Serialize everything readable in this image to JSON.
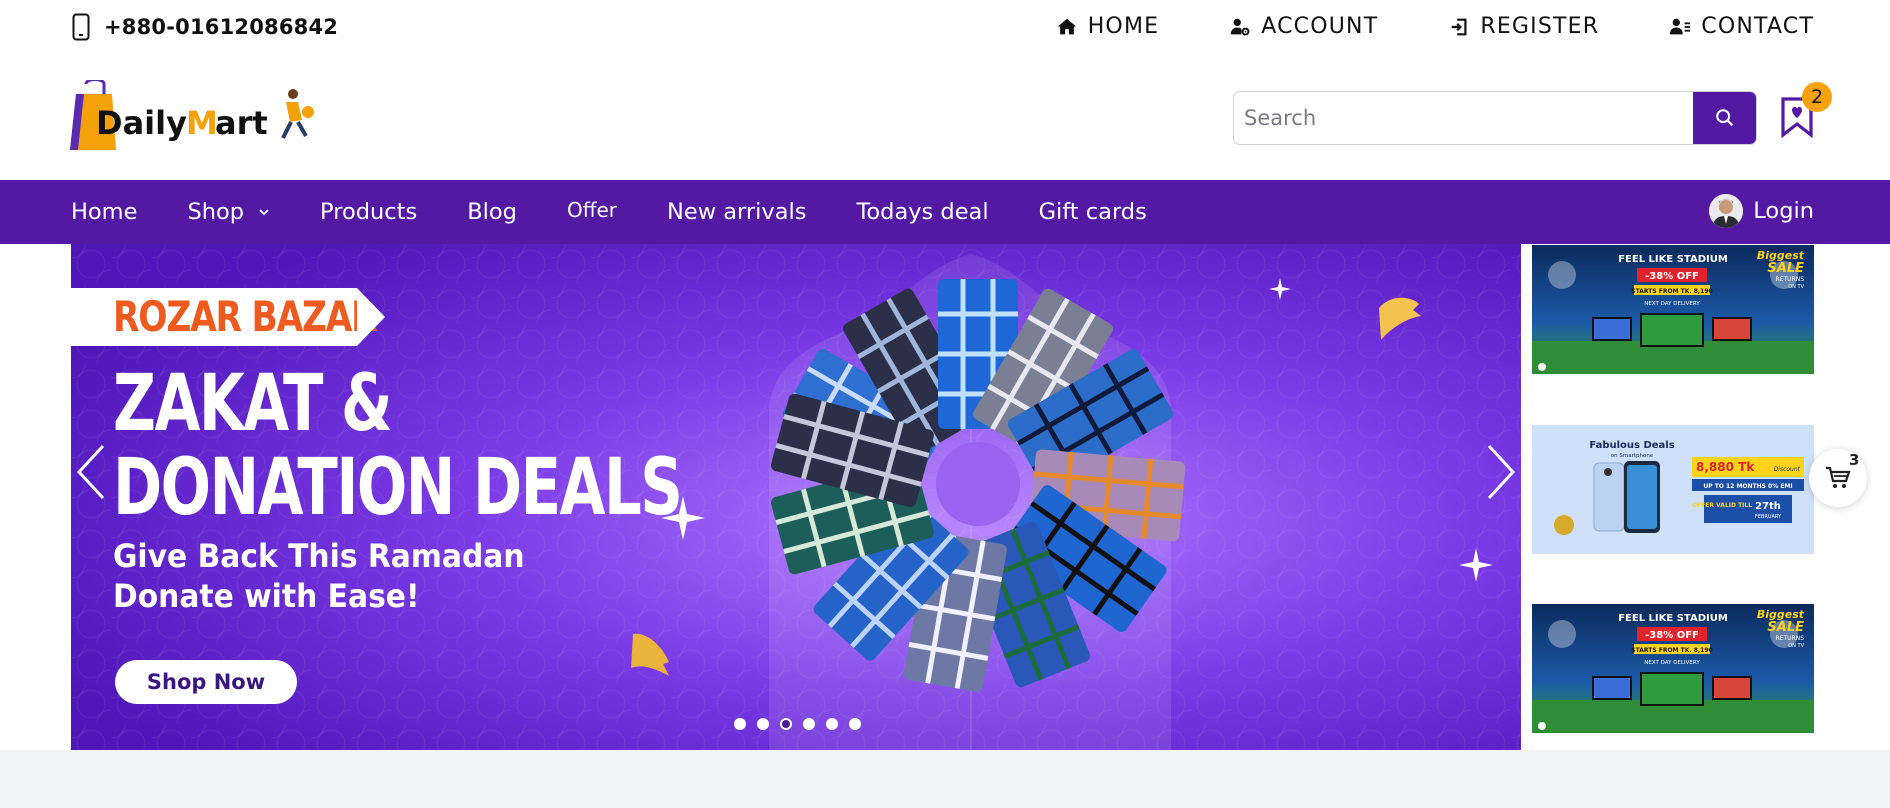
{
  "topbar": {
    "phone": "+880-01612086842",
    "links": [
      {
        "label": "HOME",
        "icon": "home-icon"
      },
      {
        "label": "ACCOUNT",
        "icon": "user-gear-icon"
      },
      {
        "label": "REGISTER",
        "icon": "sign-in-icon"
      },
      {
        "label": "CONTACT",
        "icon": "contact-icon"
      }
    ]
  },
  "header": {
    "logo_text": "DailyMart",
    "search_placeholder": "Search",
    "wishlist_count": "2"
  },
  "nav": {
    "items": [
      "Home",
      "Shop",
      "Products",
      "Blog",
      "Offer",
      "New arrivals",
      "Todays deal",
      "Gift cards"
    ],
    "login": "Login"
  },
  "hero": {
    "tag": "ROZAR BAZAR",
    "headline_1": "ZAKAT &",
    "headline_2": "DONATION DEALS",
    "sub_1": "Give Back This Ramadan",
    "sub_2": "Donate with Ease!",
    "cta": "Shop Now",
    "slides": 6,
    "active_slide": 3
  },
  "side_banners": [
    {
      "top": "FEEL LIKE STADIUM",
      "badge": "-38% OFF",
      "small": "STARTS FROM TK. 8,190",
      "deliv": "NEXT DAY DELIVERY",
      "corner_1": "Biggest",
      "corner_2": "SALE",
      "corner_3": "RETURNS",
      "corner_4": "ON TV"
    },
    {
      "title": "Fabulous Deals",
      "subtitle": "on Smartphone",
      "price": "8,880 Tk",
      "price_note": "Discount",
      "emi": "UP TO 12 MONTHS 0% EMI",
      "offer": "OFFER VALID TILL",
      "date": "27th",
      "month": "FEBRUARY"
    },
    {
      "top": "FEEL LIKE STADIUM",
      "badge": "-38% OFF",
      "small": "STARTS FROM TK. 8,190",
      "deliv": "NEXT DAY DELIVERY",
      "corner_1": "Biggest",
      "corner_2": "SALE",
      "corner_3": "RETURNS",
      "corner_4": "ON TV"
    }
  ],
  "cart": {
    "count": "3"
  },
  "colors": {
    "brand_purple": "#5319a3",
    "accent_orange": "#f5a20a"
  }
}
